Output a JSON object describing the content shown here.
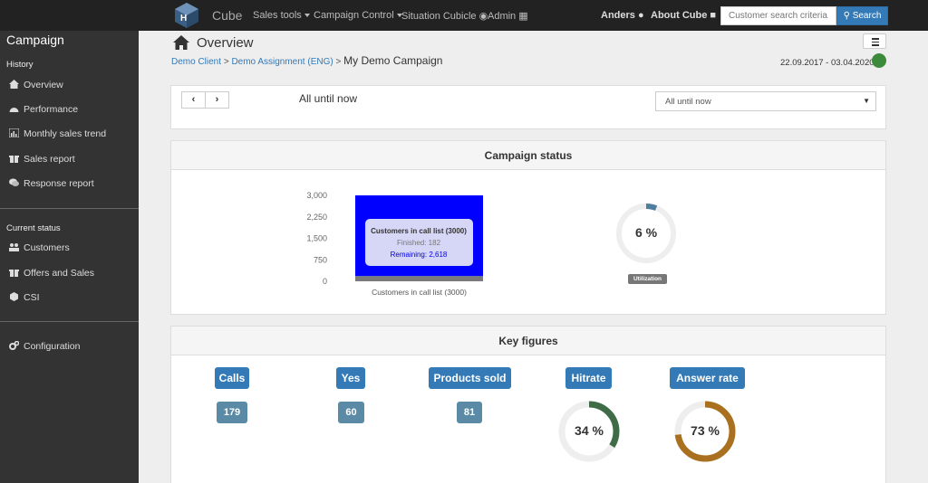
{
  "navbar": {
    "brand": "Cube",
    "menu": [
      "Sales tools",
      "Campaign Control",
      "Situation Cubicle",
      "Admin"
    ],
    "user": "Anders",
    "about": "About Cube",
    "search_placeholder": "Customer search criteria...",
    "search_button": "Search"
  },
  "sidebar": {
    "title": "Campaign",
    "history_label": "History",
    "history_items": [
      {
        "label": "Overview",
        "icon": "home-icon"
      },
      {
        "label": "Performance",
        "icon": "dashboard-icon"
      },
      {
        "label": "Monthly sales trend",
        "icon": "bar-chart-icon"
      },
      {
        "label": "Sales report",
        "icon": "gift-icon"
      },
      {
        "label": "Response report",
        "icon": "comments-icon"
      }
    ],
    "current_label": "Current status",
    "current_items": [
      {
        "label": "Customers",
        "icon": "users-icon"
      },
      {
        "label": "Offers and Sales",
        "icon": "gift-icon"
      },
      {
        "label": "CSI",
        "icon": "cube-icon"
      }
    ],
    "config_label": "Configuration"
  },
  "header": {
    "title": "Overview",
    "breadcrumb_client": "Demo Client",
    "breadcrumb_assignment": "Demo Assignment (ENG)",
    "breadcrumb_current": "My Demo Campaign",
    "sep": ">",
    "date_range": "22.09.2017 - 03.04.2020",
    "status_color": "#3c8a3c"
  },
  "period": {
    "prev": "‹",
    "next": "›",
    "label": "All until now",
    "select_value": "All until now"
  },
  "campaign_status": {
    "heading": "Campaign status",
    "tooltip_title": "Customers in call list (3000)",
    "tooltip_finished": "Finished: 182",
    "tooltip_remaining": "Remaining: 2,618",
    "utilization_value": "6 %",
    "utilization_label": "Utilization",
    "utilization_pct": 6
  },
  "key_figures": {
    "heading": "Key figures",
    "items": [
      {
        "label": "Calls",
        "value": "179"
      },
      {
        "label": "Yes",
        "value": "60"
      },
      {
        "label": "Products sold",
        "value": "81"
      }
    ],
    "hitrate": {
      "label": "Hitrate",
      "value": "34 %",
      "pct": 34,
      "color": "#3f6b47"
    },
    "answer_rate": {
      "label": "Answer rate",
      "value": "73 %",
      "pct": 73,
      "color": "#a8701f"
    }
  },
  "chart_data": {
    "type": "bar",
    "categories": [
      "Customers in call list (3000)"
    ],
    "series": [
      {
        "name": "Finished",
        "values": [
          182
        ],
        "color": "#7a7a7a"
      },
      {
        "name": "Remaining",
        "values": [
          2818
        ],
        "color": "#0000ff"
      }
    ],
    "stacked": true,
    "yticks": [
      "3,000",
      "2,250",
      "1,500",
      "750",
      "0"
    ],
    "ylim": [
      0,
      3000
    ],
    "xlabel": "Customers in call list (3000)"
  }
}
